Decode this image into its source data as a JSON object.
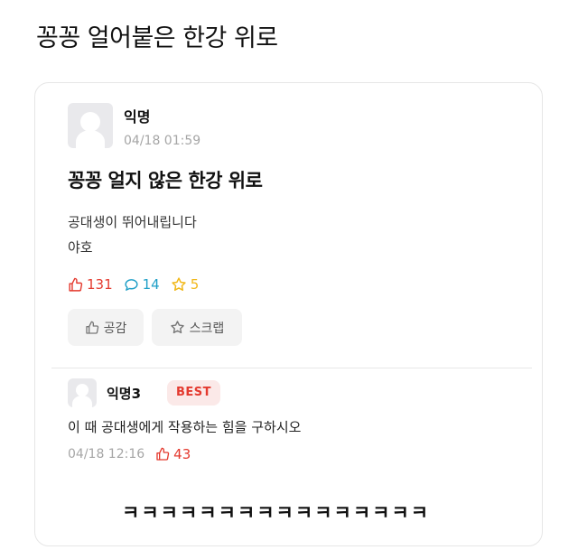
{
  "headline": "꽁꽁 얼어붙은 한강 위로",
  "post": {
    "author": "익명",
    "time": "04/18 01:59",
    "title": "꽁꽁 얼지 않은 한강 위로",
    "body_lines": [
      "공대생이 뛰어내립니다",
      "야호"
    ],
    "likes": "131",
    "comments": "14",
    "scraps": "5",
    "like_button_label": "공감",
    "scrap_button_label": "스크랩"
  },
  "comment": {
    "author": "익명3",
    "badge": "BEST",
    "text": "이 때 공대생에게 작용하는 힘을 구하시오",
    "time": "04/18 12:16",
    "likes": "43"
  },
  "reaction_text": "ㅋㅋㅋㅋㅋㅋㅋㅋㅋㅋㅋㅋㅋㅋㅋㅋ",
  "colors": {
    "like_red": "#e43a2f",
    "comment_blue": "#1f9fc7",
    "scrap_yellow": "#f1b81a",
    "meta_gray": "#a6a6a6"
  },
  "icons": {
    "like": "thumbs-up-icon",
    "comment": "speech-bubble-icon",
    "scrap": "star-icon"
  }
}
